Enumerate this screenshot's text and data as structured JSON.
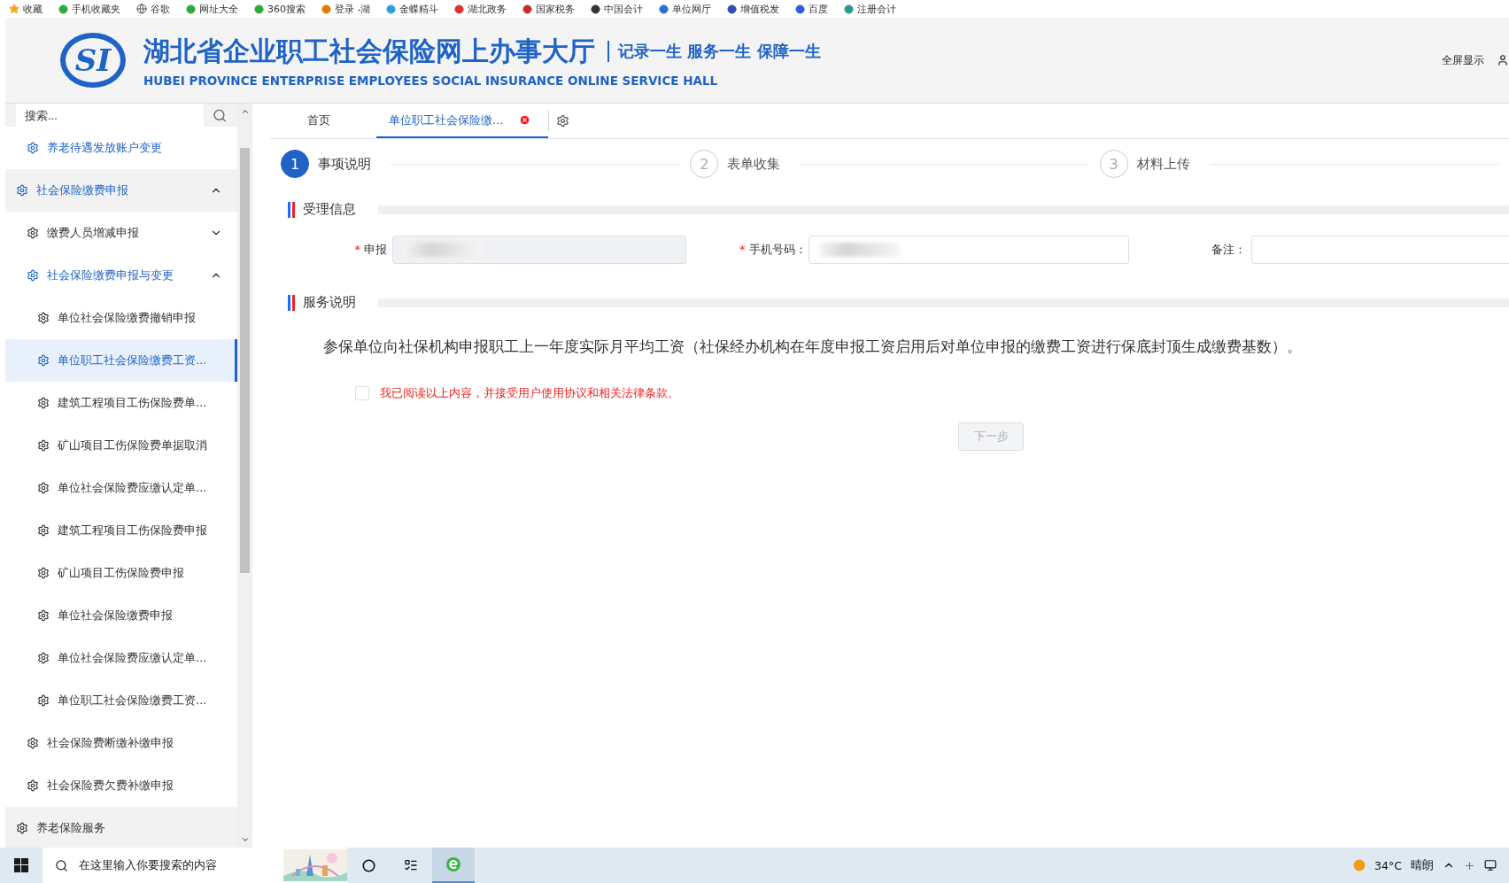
{
  "bookmarks": [
    {
      "label": "收藏"
    },
    {
      "label": "手机收藏夹"
    },
    {
      "label": "谷歌"
    },
    {
      "label": "网址大全"
    },
    {
      "label": "360搜索"
    },
    {
      "label": "登录 -湖"
    },
    {
      "label": "金蝶精斗"
    },
    {
      "label": "湖北政务"
    },
    {
      "label": "国家税务"
    },
    {
      "label": "中国会计"
    },
    {
      "label": "单位网厅"
    },
    {
      "label": "增值税发"
    },
    {
      "label": "百度"
    },
    {
      "label": "注册会计"
    }
  ],
  "header": {
    "logo": "SI",
    "title": "湖北省企业职工社会保险网上办事大厅",
    "slogan": "记录一生 服务一生 保障一生",
    "subtitle": "HUBEI PROVINCE ENTERPRISE EMPLOYEES SOCIAL INSURANCE ONLINE SERVICE HALL",
    "fullscreen": "全屏显示"
  },
  "sidebar": {
    "search": {
      "placeholder": "搜索..."
    },
    "items": [
      {
        "children": [
          {
            "label": "养老待遇发放账户变更",
            "active": true,
            "selected": false
          }
        ]
      },
      {
        "label": "社会保险缴费申报",
        "active": true,
        "selected": false,
        "expanded": true,
        "children": [
          {
            "label": "缴费人员增减申报",
            "active": false,
            "selected": false,
            "expanded": false
          },
          {
            "label": "社会保险缴费申报与变更",
            "active": true,
            "selected": false,
            "expanded": true,
            "children": [
              {
                "label": "单位社会保险缴费撤销申报",
                "active": false,
                "selected": false
              },
              {
                "label": "单位职工社会保险缴费工资...",
                "active": true,
                "selected": true
              },
              {
                "label": "建筑工程项目工伤保险费单...",
                "active": false,
                "selected": false
              },
              {
                "label": "矿山项目工伤保险费单据取消",
                "active": false,
                "selected": false
              },
              {
                "label": "单位社会保险费应缴认定单...",
                "active": false,
                "selected": false
              },
              {
                "label": "建筑工程项目工伤保险费申报",
                "active": false,
                "selected": false
              },
              {
                "label": "矿山项目工伤保险费申报",
                "active": false,
                "selected": false
              },
              {
                "label": "单位社会保险缴费申报",
                "active": false,
                "selected": false
              },
              {
                "label": "单位社会保险费应缴认定单...",
                "active": false,
                "selected": false
              },
              {
                "label": "单位职工社会保险缴费工资...",
                "active": false,
                "selected": false
              }
            ]
          },
          {
            "label": "社会保险费断缴补缴申报",
            "active": false,
            "selected": false
          },
          {
            "label": "社会保险费欠费补缴申报",
            "active": false,
            "selected": false
          }
        ]
      },
      {
        "label": "养老保险服务",
        "active": false,
        "selected": false
      }
    ]
  },
  "tabs": [
    {
      "label": "首页",
      "selected": false,
      "closable": false
    },
    {
      "label": "单位职工社会保险缴...",
      "selected": true,
      "closable": true
    }
  ],
  "steps": [
    {
      "number": "1",
      "label": "事项说明",
      "selected": true
    },
    {
      "number": "2",
      "label": "表单收集",
      "selected": false
    },
    {
      "number": "3",
      "label": "材料上传",
      "selected": false
    }
  ],
  "sections": [
    {
      "title": "受理信息",
      "required_mark": "*",
      "fields": [
        {
          "label": "申报",
          "required": true,
          "disabled": true,
          "redacted": true
        },
        {
          "label": "手机号码：",
          "required": true,
          "disabled": false,
          "redacted": true
        },
        {
          "label": "备注：",
          "required": false,
          "disabled": false,
          "redacted": false
        }
      ]
    },
    {
      "title": "服务说明",
      "text": "参保单位向社保机构申报职工上一年度实际月平均工资（社保经办机构在年度申报工资启用后对单位申报的缴费工资进行保底封顶生成缴费基数）。"
    }
  ],
  "agreement": {
    "label": "我已阅读以上内容，并接受用户使用协议和相关法律条款。",
    "checked": false
  },
  "next_button": {
    "label": "下一步",
    "disabled": true
  },
  "taskbar": {
    "search": {
      "placeholder": "在这里输入你要搜索的内容"
    },
    "weather": {
      "temperature": "34°C",
      "condition": "晴朗"
    }
  }
}
